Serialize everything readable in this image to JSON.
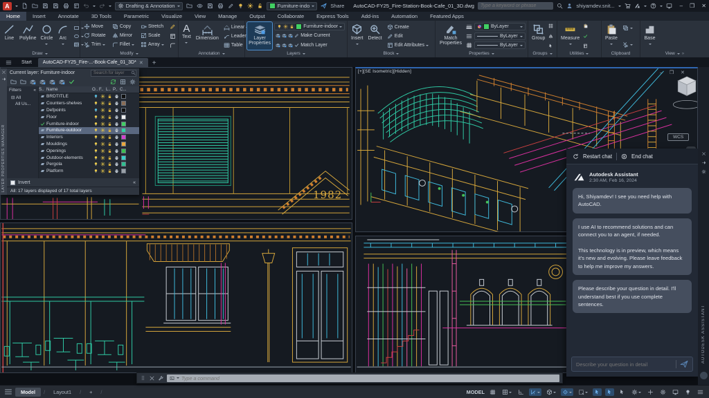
{
  "titlebar": {
    "logo_letter": "A",
    "qat_icons": [
      "new-file",
      "open-file",
      "save",
      "save-as",
      "plot",
      "sheet-set"
    ],
    "workspace": "Drafting & Annotation",
    "mid_icons": [
      "open-from-web",
      "visibility",
      "save-to-web",
      "print",
      "annotate"
    ],
    "quick_layer": "Furniture-indo",
    "quick_layer_color": "#41cf63",
    "share_label": "Share",
    "filename": "AutoCAD-FY25_Fire-Station-Book-Cafe_01_3D.dwg",
    "search_placeholder": "Type a keyword or phrase",
    "username": "shiyamdev.snit...",
    "window_minimize": "–",
    "window_maximize": "❒",
    "window_close": "✕"
  },
  "ribbon_tabs": {
    "active": "Home",
    "items": [
      "Home",
      "Insert",
      "Annotate",
      "3D Tools",
      "Parametric",
      "Visualize",
      "View",
      "Manage",
      "Output",
      "Collaborate",
      "Express Tools",
      "Add-ins",
      "Automation",
      "Featured Apps"
    ]
  },
  "ribbon": {
    "draw": {
      "label": "Draw",
      "buttons": [
        "Line",
        "Polyline",
        "Circle",
        "Arc"
      ]
    },
    "modify": {
      "label": "Modify",
      "buttons": [
        "Move",
        "Rotate",
        "Trim",
        "Copy",
        "Mirror",
        "Fillet",
        "Stretch",
        "Scale",
        "Array"
      ]
    },
    "annotation": {
      "label": "Annotation",
      "text_button": "Text",
      "dimension_button": "Dimension",
      "rows": [
        "Linear",
        "Leader",
        "Table"
      ]
    },
    "layers": {
      "label": "Layers",
      "layer_properties": "Layer Properties",
      "combo_value": "Furniture-indoor",
      "combo_color": "#41cf63",
      "make_current": "Make Current",
      "match_layer": "Match Layer"
    },
    "block": {
      "label": "Block",
      "insert": "Insert",
      "detect": "Detect",
      "rows": [
        "Create",
        "Edit",
        "Edit Attributes"
      ]
    },
    "properties": {
      "label": "Properties",
      "match_properties": "Match Properties",
      "combo1": "ByLayer",
      "combo2": "ByLayer",
      "combo3": "ByLayer"
    },
    "groups": {
      "label": "Groups",
      "group": "Group"
    },
    "utilities": {
      "label": "Utilities",
      "measure": "Measure"
    },
    "clipboard": {
      "label": "Clipboard",
      "paste": "Paste"
    },
    "view": {
      "label": "View",
      "base": "Base"
    }
  },
  "file_tabs": {
    "start": "Start",
    "drawing": "AutoCAD-FY25_Fire-...-Book-Cafe_01_3D*"
  },
  "layer_palette": {
    "vertical_title": "LAYER PROPERTIES MANAGER",
    "current_layer": "Current layer: Furniture-indoor",
    "search_placeholder": "Search for layer",
    "toolbar_icons": [
      "new-property-filter",
      "new-group-filter",
      "layer-states",
      "new-layer",
      "new-frozen-layer",
      "delete-layer",
      "set-current",
      "refresh",
      "isolate",
      "settings"
    ],
    "filters_label": "Filters",
    "tree_root": "All",
    "tree_child": "All Us...",
    "columns": [
      "S..",
      "Name",
      "O..",
      "F..",
      "L..",
      "P..",
      "C..."
    ],
    "invert_label": "Invert",
    "status": "All: 17 layers displayed of 17 total layers",
    "layers": [
      {
        "name": "BRDTITLE",
        "color": "#101010",
        "bulb": "off"
      },
      {
        "name": "Counters-shelves",
        "color": "#8a6e57",
        "bulb": "on"
      },
      {
        "name": "Defpoints",
        "color": "#101010",
        "bulb": "off"
      },
      {
        "name": "Floor",
        "color": "#ededed",
        "bulb": "on"
      },
      {
        "name": "Furniture-indoor",
        "color": "#41cf63",
        "bulb": "on",
        "current": true
      },
      {
        "name": "Furniture-outdoor",
        "color": "#2fd3a2",
        "bulb": "on",
        "selected": true
      },
      {
        "name": "Interiors",
        "color": "#d63fd0",
        "bulb": "on"
      },
      {
        "name": "Mouldings",
        "color": "#eaa73e",
        "bulb": "on"
      },
      {
        "name": "Openings",
        "color": "#3dbf50",
        "bulb": "on"
      },
      {
        "name": "Outdoor-elements",
        "color": "#38cfc6",
        "bulb": "on"
      },
      {
        "name": "Pergola",
        "color": "#2fbf90",
        "bulb": "on"
      },
      {
        "name": "Platform",
        "color": "#9aa0a8",
        "bulb": "on"
      }
    ]
  },
  "viewport": {
    "label": "[+][SE Isometric][Hidden]",
    "wcs_label": "WCS",
    "year_text": "1982",
    "window_controls": "–  ❒  ✕"
  },
  "assistant": {
    "restart_label": "Restart chat",
    "end_label": "End chat",
    "name": "Autodesk Assistant",
    "timestamp": "2:30 AM, Feb 16, 2024",
    "messages": [
      "Hi, Shiyamdev! I see you need help with AutoCAD.",
      "I use AI to recommend solutions and can connect you to an agent, if needed.\n\nThis technology is in preview, which means it's new and evolving. Please leave feedback to help me improve my answers.",
      "Please describe your question in detail. I'll understand best if you use complete sentences."
    ],
    "input_placeholder": "Describe your question in detail",
    "strip_icons": [
      "close",
      "auto-hide",
      "settings"
    ],
    "vertical_title": "AUTODESK ASSISTANT"
  },
  "command_bar": {
    "placeholder": "Type a command",
    "icons": [
      "grip",
      "close",
      "customize",
      "recent-commands"
    ]
  },
  "statusbar": {
    "model_tab": "Model",
    "layout_tab": "Layout1",
    "model_label": "MODEL",
    "icons": [
      {
        "n": "grid"
      },
      {
        "n": "snap",
        "caret": true
      },
      {
        "n": "ortho"
      },
      {
        "n": "polar",
        "caret": true,
        "active": true
      },
      {
        "n": "isodraft",
        "caret": true
      },
      {
        "n": "osnap",
        "caret": true,
        "active": true
      },
      {
        "n": "selection-window",
        "caret": true
      },
      {
        "n": "annotation-visibility",
        "active": true
      },
      {
        "n": "annotation-autoscale",
        "active": true
      },
      {
        "n": "annotation-scale"
      },
      {
        "n": "settings",
        "caret": true
      },
      {
        "n": "plus"
      },
      {
        "n": "workspace"
      },
      {
        "n": "annotation-monitor"
      },
      {
        "n": "isolate-objects"
      },
      {
        "n": "fullscreen"
      }
    ]
  },
  "colors": {
    "accent_blue": "#4a90d9",
    "highlight_bg": "#1d3b57",
    "cad_yellow": "#d4a53b",
    "cad_orange": "#cf7f2e",
    "cad_teal": "#2fc9a4",
    "cad_cyan": "#3fb9db",
    "cad_magenta": "#d9309f",
    "cad_red": "#c94040",
    "cad_green": "#45c055"
  }
}
